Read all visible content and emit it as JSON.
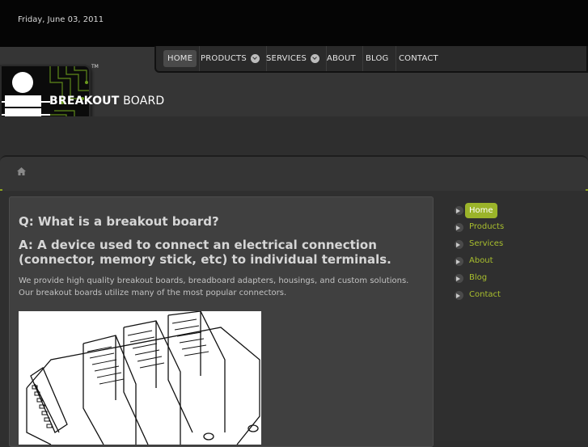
{
  "top": {
    "date": "Friday, June 03, 2011"
  },
  "nav": {
    "items": [
      {
        "label": "HOME",
        "active": true
      },
      {
        "label": "PRODUCTS",
        "dropdown": true
      },
      {
        "label": "SERVICES",
        "dropdown": true
      },
      {
        "label": "ABOUT"
      },
      {
        "label": "BLOG"
      },
      {
        "label": "CONTACT"
      }
    ]
  },
  "logo": {
    "word1": "BREAKOUT",
    "word2": "BOARD",
    "tm": "TM"
  },
  "breadcrumb": {
    "icon": "home-icon"
  },
  "main": {
    "question": "Q:  What is a breakout board?",
    "answer": "A:  A device used to connect an electrical connection (connector, memory stick, etc) to individual terminals.",
    "paragraph": "We provide high quality breakout boards, breadboard adapters, housings, and custom solutions.  Our breakout boards utilize many of the most popular connectors."
  },
  "sidebar": {
    "items": [
      {
        "label": "Home",
        "active": true
      },
      {
        "label": "Products"
      },
      {
        "label": "Services"
      },
      {
        "label": "About"
      },
      {
        "label": "Blog"
      },
      {
        "label": "Contact"
      }
    ]
  },
  "colors": {
    "accent": "#9bb42a",
    "link": "#a9bf2e",
    "background": "#2e2e2e"
  }
}
